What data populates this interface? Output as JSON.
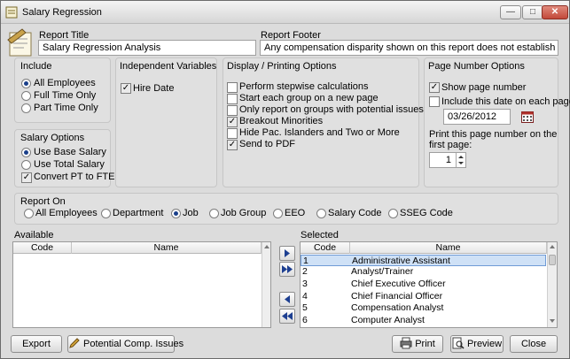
{
  "window": {
    "title": "Salary Regression"
  },
  "report_title": {
    "label": "Report Title",
    "value": "Salary Regression Analysis"
  },
  "report_footer": {
    "label": "Report Footer",
    "value": "Any compensation disparity shown on this report does not establish impermissibl"
  },
  "include": {
    "title": "Include",
    "options": [
      "All Employees",
      "Full Time Only",
      "Part Time Only"
    ],
    "selected": 0
  },
  "independent_variables": {
    "title": "Independent Variables",
    "hire_date": "Hire Date"
  },
  "display_options": {
    "title": "Display / Printing Options",
    "items": [
      {
        "label": "Perform stepwise calculations",
        "checked": false
      },
      {
        "label": "Start each group on a new page",
        "checked": false
      },
      {
        "label": "Only report on groups with potential issues",
        "checked": false
      },
      {
        "label": "Breakout Minorities",
        "checked": true
      },
      {
        "label": "Hide Pac. Islanders and Two or More",
        "checked": false
      },
      {
        "label": "Send to PDF",
        "checked": true
      }
    ]
  },
  "page_number": {
    "title": "Page Number Options",
    "show_label": "Show page number",
    "include_date_label": "Include this date on each page",
    "date_value": "03/26/2012",
    "print_label_1": "Print this page number on the",
    "print_label_2": "first page:",
    "start_value": "1"
  },
  "salary_options": {
    "title": "Salary Options",
    "options": [
      "Use Base Salary",
      "Use Total Salary"
    ],
    "selected": 0,
    "convert_label": "Convert PT to FTE"
  },
  "report_on": {
    "title": "Report On",
    "options": [
      "All Employees",
      "Department",
      "Job",
      "Job Group",
      "EEO",
      "Salary Code",
      "SSEG Code"
    ],
    "selected": 2
  },
  "available": {
    "label": "Available",
    "columns": [
      "Code",
      "Name"
    ]
  },
  "selected_list": {
    "label": "Selected",
    "columns": [
      "Code",
      "Name"
    ],
    "rows": [
      {
        "code": "1",
        "name": "Administrative Assistant"
      },
      {
        "code": "2",
        "name": "Analyst/Trainer"
      },
      {
        "code": "3",
        "name": "Chief Executive Officer"
      },
      {
        "code": "4",
        "name": "Chief Financial Officer"
      },
      {
        "code": "5",
        "name": "Compensation Analyst"
      },
      {
        "code": "6",
        "name": "Computer Analyst"
      }
    ]
  },
  "buttons": {
    "export": "Export",
    "potential": "Potential Comp. Issues",
    "print": "Print",
    "preview": "Preview",
    "close": "Close"
  }
}
